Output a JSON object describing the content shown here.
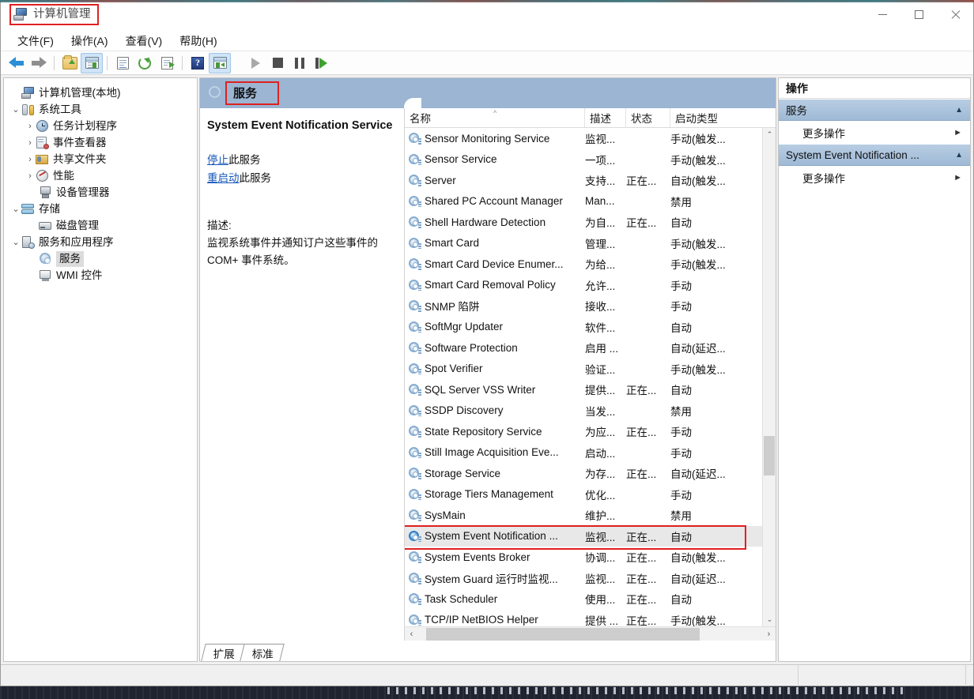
{
  "window": {
    "title": "计算机管理",
    "title_icon": "computer-management-icon",
    "minimize_label": "最小化",
    "maximize_label": "最大化",
    "close_label": "关闭"
  },
  "menubar": {
    "items": [
      {
        "label": "文件(F)",
        "name": "menu-file"
      },
      {
        "label": "操作(A)",
        "name": "menu-action"
      },
      {
        "label": "查看(V)",
        "name": "menu-view"
      },
      {
        "label": "帮助(H)",
        "name": "menu-help"
      }
    ]
  },
  "toolbar": {
    "buttons": [
      {
        "name": "back-button",
        "icon": "back-arrow-icon"
      },
      {
        "name": "forward-button",
        "icon": "forward-arrow-icon"
      },
      {
        "name": "up-one-level-button",
        "icon": "folder-up-icon"
      },
      {
        "name": "show-hide-console-tree-button",
        "icon": "console-tree-icon",
        "selected": true
      },
      {
        "name": "properties-button",
        "icon": "properties-icon"
      },
      {
        "name": "refresh-button",
        "icon": "refresh-icon"
      },
      {
        "name": "export-list-button",
        "icon": "export-list-icon"
      },
      {
        "name": "help-button",
        "icon": "help-icon"
      },
      {
        "name": "show-hide-action-pane-button",
        "icon": "action-pane-icon",
        "selected": true
      },
      {
        "name": "start-service-button",
        "icon": "play-icon"
      },
      {
        "name": "stop-service-button",
        "icon": "stop-icon"
      },
      {
        "name": "pause-service-button",
        "icon": "pause-icon"
      },
      {
        "name": "restart-service-button",
        "icon": "restart-icon"
      }
    ]
  },
  "tree": {
    "nodes": [
      {
        "label": "计算机管理(本地)",
        "indent": 1,
        "chevron": "",
        "icon": "computer-icon",
        "name": "tree-node-computer-management",
        "selected": false
      },
      {
        "label": "系统工具",
        "indent": 1,
        "chevron": "⌄",
        "icon": "system-tools-icon",
        "name": "tree-node-system-tools",
        "selected": false
      },
      {
        "label": "任务计划程序",
        "indent": 2,
        "chevron": "›",
        "icon": "task-scheduler-icon",
        "name": "tree-node-task-scheduler",
        "selected": false
      },
      {
        "label": "事件查看器",
        "indent": 2,
        "chevron": "›",
        "icon": "event-viewer-icon",
        "name": "tree-node-event-viewer",
        "selected": false
      },
      {
        "label": "共享文件夹",
        "indent": 2,
        "chevron": "›",
        "icon": "shared-folders-icon",
        "name": "tree-node-shared-folders",
        "selected": false
      },
      {
        "label": "性能",
        "indent": 2,
        "chevron": "›",
        "icon": "performance-icon",
        "name": "tree-node-performance",
        "selected": false
      },
      {
        "label": "设备管理器",
        "indent": 2,
        "chevron": "",
        "icon": "device-manager-icon",
        "name": "tree-node-device-manager",
        "selected": false
      },
      {
        "label": "存储",
        "indent": 1,
        "chevron": "⌄",
        "icon": "storage-icon",
        "name": "tree-node-storage",
        "selected": false
      },
      {
        "label": "磁盘管理",
        "indent": 2,
        "chevron": "",
        "icon": "disk-management-icon",
        "name": "tree-node-disk-management",
        "selected": false
      },
      {
        "label": "服务和应用程序",
        "indent": 1,
        "chevron": "⌄",
        "icon": "services-apps-icon",
        "name": "tree-node-services-and-applications",
        "selected": false
      },
      {
        "label": "服务",
        "indent": 2,
        "chevron": "",
        "icon": "services-gear-icon",
        "name": "tree-node-services",
        "selected": true
      },
      {
        "label": "WMI 控件",
        "indent": 2,
        "chevron": "",
        "icon": "wmi-control-icon",
        "name": "tree-node-wmi-control",
        "selected": false
      }
    ]
  },
  "banner": {
    "title": "服务",
    "icon": "services-gear-icon",
    "highlighted": true
  },
  "detail": {
    "service_name": "System Event Notification Service",
    "links": [
      {
        "link_text": "停止",
        "suffix": "此服务",
        "name": "stop-service-link"
      },
      {
        "link_text": "重启动",
        "suffix": "此服务",
        "name": "restart-service-link"
      }
    ],
    "description_label": "描述:",
    "description_lines": [
      "监视系统事件并通知订户这些事件的",
      "COM+ 事件系统。"
    ]
  },
  "list": {
    "columns": [
      {
        "label": "名称",
        "name": "column-name",
        "sorted": "asc"
      },
      {
        "label": "描述",
        "name": "column-description"
      },
      {
        "label": "状态",
        "name": "column-status"
      },
      {
        "label": "启动类型",
        "name": "column-startup-type"
      }
    ],
    "sort_indicator": "^",
    "rows": [
      {
        "name": "Sensor Monitoring Service",
        "description": "监视...",
        "status": "",
        "startup": "手动(触发..."
      },
      {
        "name": "Sensor Service",
        "description": "一项...",
        "status": "",
        "startup": "手动(触发..."
      },
      {
        "name": "Server",
        "description": "支持...",
        "status": "正在...",
        "startup": "自动(触发..."
      },
      {
        "name": "Shared PC Account Manager",
        "description": "Man...",
        "status": "",
        "startup": "禁用"
      },
      {
        "name": "Shell Hardware Detection",
        "description": "为自...",
        "status": "正在...",
        "startup": "自动"
      },
      {
        "name": "Smart Card",
        "description": "管理...",
        "status": "",
        "startup": "手动(触发..."
      },
      {
        "name": "Smart Card Device Enumer...",
        "description": "为给...",
        "status": "",
        "startup": "手动(触发..."
      },
      {
        "name": "Smart Card Removal Policy",
        "description": "允许...",
        "status": "",
        "startup": "手动"
      },
      {
        "name": "SNMP 陷阱",
        "description": "接收...",
        "status": "",
        "startup": "手动"
      },
      {
        "name": "SoftMgr Updater",
        "description": "软件...",
        "status": "",
        "startup": "自动"
      },
      {
        "name": "Software Protection",
        "description": "启用 ...",
        "status": "",
        "startup": "自动(延迟..."
      },
      {
        "name": "Spot Verifier",
        "description": "验证...",
        "status": "",
        "startup": "手动(触发..."
      },
      {
        "name": "SQL Server VSS Writer",
        "description": "提供...",
        "status": "正在...",
        "startup": "自动"
      },
      {
        "name": "SSDP Discovery",
        "description": "当发...",
        "status": "",
        "startup": "禁用"
      },
      {
        "name": "State Repository Service",
        "description": "为应...",
        "status": "正在...",
        "startup": "手动"
      },
      {
        "name": "Still Image Acquisition Eve...",
        "description": "启动...",
        "status": "",
        "startup": "手动"
      },
      {
        "name": "Storage Service",
        "description": "为存...",
        "status": "正在...",
        "startup": "自动(延迟..."
      },
      {
        "name": "Storage Tiers Management",
        "description": "优化...",
        "status": "",
        "startup": "手动"
      },
      {
        "name": "SysMain",
        "description": "维护...",
        "status": "",
        "startup": "禁用"
      },
      {
        "name": "System Event Notification ...",
        "description": "监视...",
        "status": "正在...",
        "startup": "自动",
        "selected": true,
        "highlighted": true
      },
      {
        "name": "System Events Broker",
        "description": "协调...",
        "status": "正在...",
        "startup": "自动(触发..."
      },
      {
        "name": "System Guard 运行时监视...",
        "description": "监视...",
        "status": "正在...",
        "startup": "自动(延迟..."
      },
      {
        "name": "Task Scheduler",
        "description": "使用...",
        "status": "正在...",
        "startup": "自动"
      },
      {
        "name": "TCP/IP NetBIOS Helper",
        "description": "提供 ...",
        "status": "正在...",
        "startup": "手动(触发..."
      }
    ]
  },
  "scrollbars": {
    "vertical": {
      "up_arrow": "⌃",
      "down_arrow": "⌄",
      "thumb_top_pct": 60,
      "thumb_height_pct": 8
    },
    "horizontal": {
      "left_arrow": "‹",
      "right_arrow": "›",
      "thumb_left_pct": 6,
      "thumb_width_pct": 78
    }
  },
  "tabs": [
    {
      "label": "扩展",
      "name": "tab-extended",
      "active": false
    },
    {
      "label": "标准",
      "name": "tab-standard",
      "active": true
    }
  ],
  "actions": {
    "header": "操作",
    "groups": [
      {
        "title": "服务",
        "name": "action-group-services",
        "caret": "▲",
        "items": [
          {
            "label": "更多操作",
            "caret": "►",
            "name": "action-more-actions-services"
          }
        ]
      },
      {
        "title": "System Event Notification ...",
        "name": "action-group-selected-service",
        "caret": "▲",
        "items": [
          {
            "label": "更多操作",
            "caret": "►",
            "name": "action-more-actions-selected"
          }
        ]
      }
    ]
  },
  "colors": {
    "banner_blue": "#9bb5d3",
    "highlight_red": "#e02020",
    "selection_gray": "#e8e8e8",
    "link_blue": "#1657b8",
    "action_group_blue": "#9fbad6"
  }
}
